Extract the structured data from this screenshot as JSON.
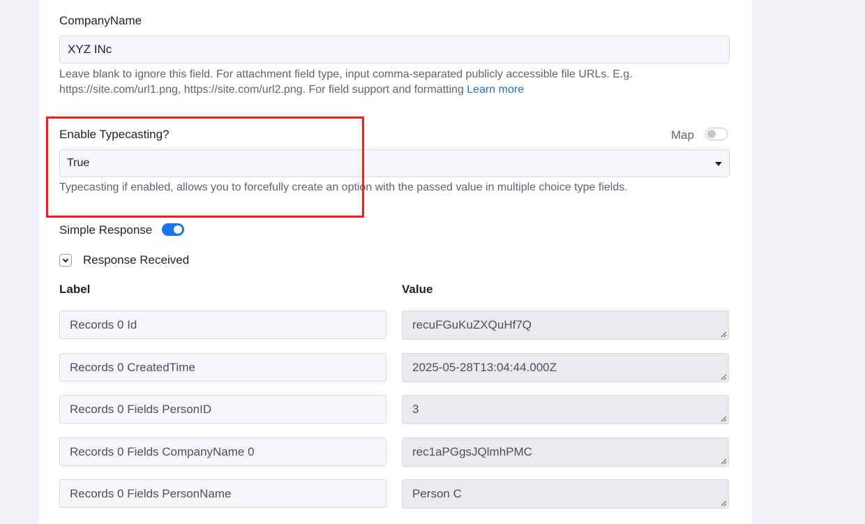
{
  "company_field": {
    "label": "CompanyName",
    "value": "XYZ INc",
    "help_line1": "Leave blank to ignore this field. For attachment field type, input comma-separated publicly accessible file URLs. E.g.",
    "help_line2": "https://site.com/url1.png, https://site.com/url2.png. For field support and formatting ",
    "help_link": "Learn more"
  },
  "typecasting": {
    "label": "Enable Typecasting?",
    "map_label": "Map",
    "map_enabled": false,
    "selected": "True",
    "help": "Typecasting if enabled, allows you to forcefully create an option with the passed value in multiple choice type fields."
  },
  "simple_response": {
    "label": "Simple Response",
    "enabled": true
  },
  "response_received": {
    "label": "Response Received",
    "expanded": true
  },
  "response_table": {
    "label_header": "Label",
    "value_header": "Value",
    "rows": [
      {
        "label": "Records 0 Id",
        "value": "recuFGuKuZXQuHf7Q"
      },
      {
        "label": "Records 0 CreatedTime",
        "value": "2025-05-28T13:04:44.000Z"
      },
      {
        "label": "Records 0 Fields PersonID",
        "value": "3"
      },
      {
        "label": "Records 0 Fields CompanyName 0",
        "value": "rec1aPGgsJQlmhPMC"
      },
      {
        "label": "Records 0 Fields PersonName",
        "value": "Person C"
      }
    ]
  },
  "colors": {
    "accent": "#1a73e8",
    "highlight": "#ff1a1a",
    "link": "#1f6fd6"
  }
}
